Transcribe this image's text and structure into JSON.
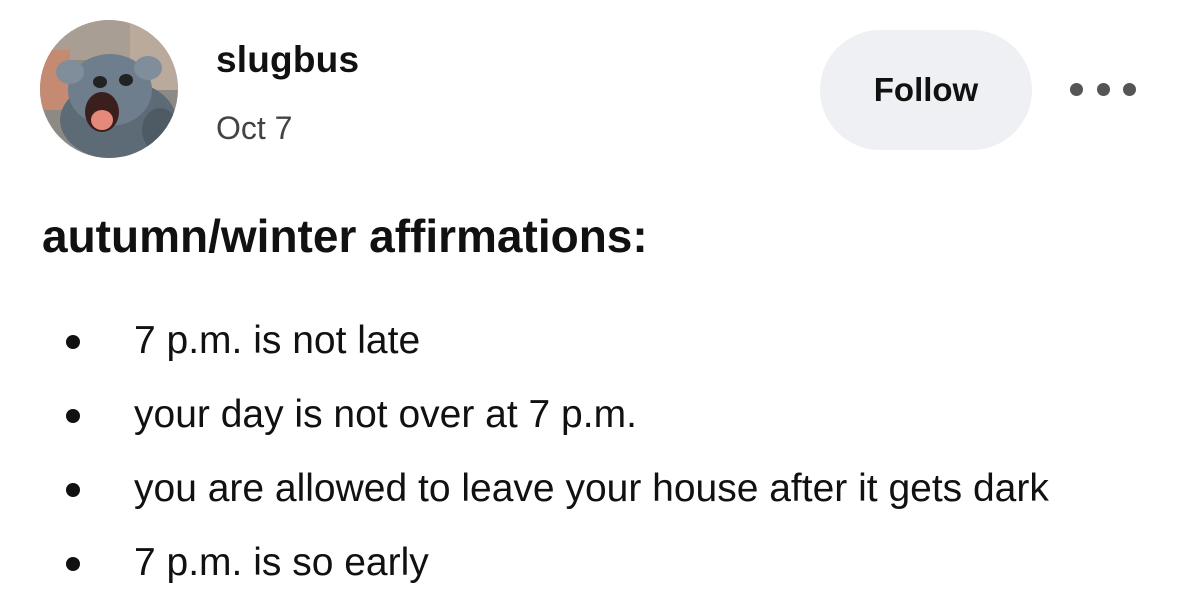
{
  "post": {
    "author": "slugbus",
    "date": "Oct 7",
    "avatar_icon": "rat-avatar-icon",
    "follow_label": "Follow",
    "more_icon": "ellipsis-icon",
    "title": "autumn/winter affirmations:",
    "items": [
      "7 p.m. is not late",
      "your day is not over at 7 p.m.",
      "you are allowed to leave your house after it gets dark",
      "7 p.m. is so early"
    ]
  },
  "colors": {
    "follow_button_bg": "#eef0f3",
    "text": "#111111",
    "secondary_text": "#444444"
  }
}
